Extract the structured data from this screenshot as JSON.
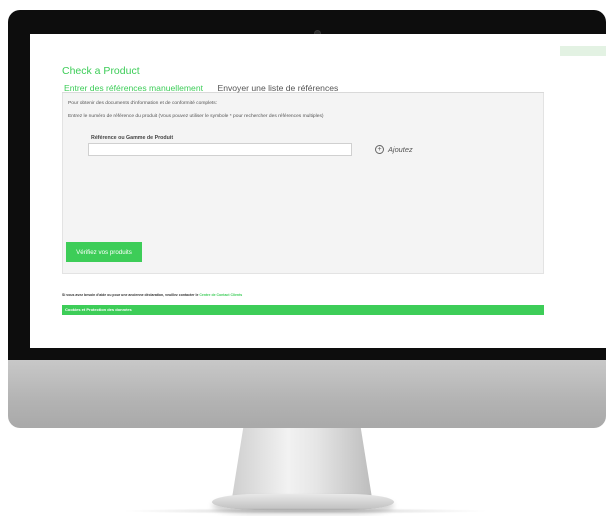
{
  "page": {
    "title": "Check a Product",
    "tabs": [
      {
        "label": "Entrer des références manuellement",
        "active": true
      },
      {
        "label": "Envoyer une liste de références",
        "active": false
      }
    ],
    "intro": "Pour obtenir des documents d'information et de conformité complets:",
    "instruction": "Entrez le numéro de référence du produit (Vous pouvez utiliser le symbole * pour rechercher des références multiples)",
    "field_label": "Référence ou Gamme de Produit",
    "field_value": "",
    "add_label": "Ajoutez",
    "add_icon": "plus-circle-icon",
    "check_button": "Vérifiez vos produits",
    "help_text": "Si vous avez besoin d'aide ou pour une ancienne déclaration, veuillez contacter le",
    "help_link": "Centre de Contact Clients",
    "footer_link": "Cookies et Protection des données"
  },
  "colors": {
    "accent": "#3dcd58",
    "bezel": "#0d0d0d",
    "content_bg": "#f4f4f4"
  }
}
